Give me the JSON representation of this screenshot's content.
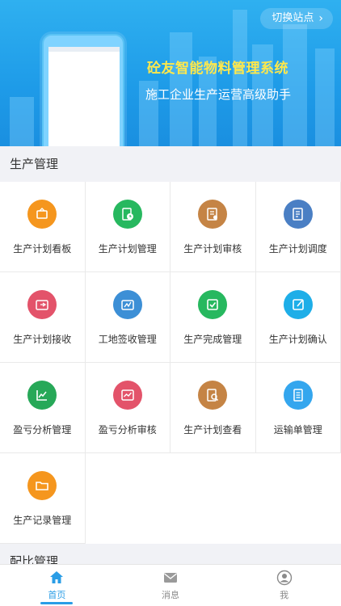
{
  "banner": {
    "switch_site": "切换站点",
    "title": "砼友智能物料管理系统",
    "subtitle": "施工企业生产运营高级助手"
  },
  "sections": [
    {
      "title": "生产管理",
      "items": [
        {
          "label": "生产计划看板",
          "color": "#f5961e",
          "icon": "board-icon"
        },
        {
          "label": "生产计划管理",
          "color": "#27b85f",
          "icon": "clock-doc-icon"
        },
        {
          "label": "生产计划审核",
          "color": "#c58445",
          "icon": "audit-doc-icon"
        },
        {
          "label": "生产计划调度",
          "color": "#4a7fc4",
          "icon": "schedule-icon"
        },
        {
          "label": "生产计划接收",
          "color": "#e3536a",
          "icon": "receive-icon"
        },
        {
          "label": "工地签收管理",
          "color": "#3c8fd6",
          "icon": "sign-icon"
        },
        {
          "label": "生产完成管理",
          "color": "#27b85f",
          "icon": "check-icon"
        },
        {
          "label": "生产计划确认",
          "color": "#1eaee8",
          "icon": "confirm-icon"
        },
        {
          "label": "盈亏分析管理",
          "color": "#27a858",
          "icon": "chart-icon"
        },
        {
          "label": "盈亏分析审核",
          "color": "#e3536a",
          "icon": "chart-review-icon"
        },
        {
          "label": "生产计划查看",
          "color": "#c58445",
          "icon": "view-icon"
        },
        {
          "label": "运输单管理",
          "color": "#34a6ee",
          "icon": "transport-icon"
        },
        {
          "label": "生产记录管理",
          "color": "#f5961e",
          "icon": "folder-icon"
        }
      ]
    },
    {
      "title": "配比管理"
    }
  ],
  "tabbar": [
    {
      "label": "首页",
      "icon": "home-icon",
      "active": true
    },
    {
      "label": "消息",
      "icon": "mail-icon",
      "active": false
    },
    {
      "label": "我",
      "icon": "user-icon",
      "active": false
    }
  ],
  "colors": {
    "accent": "#2a9de6",
    "banner_title": "#ffe84b"
  }
}
